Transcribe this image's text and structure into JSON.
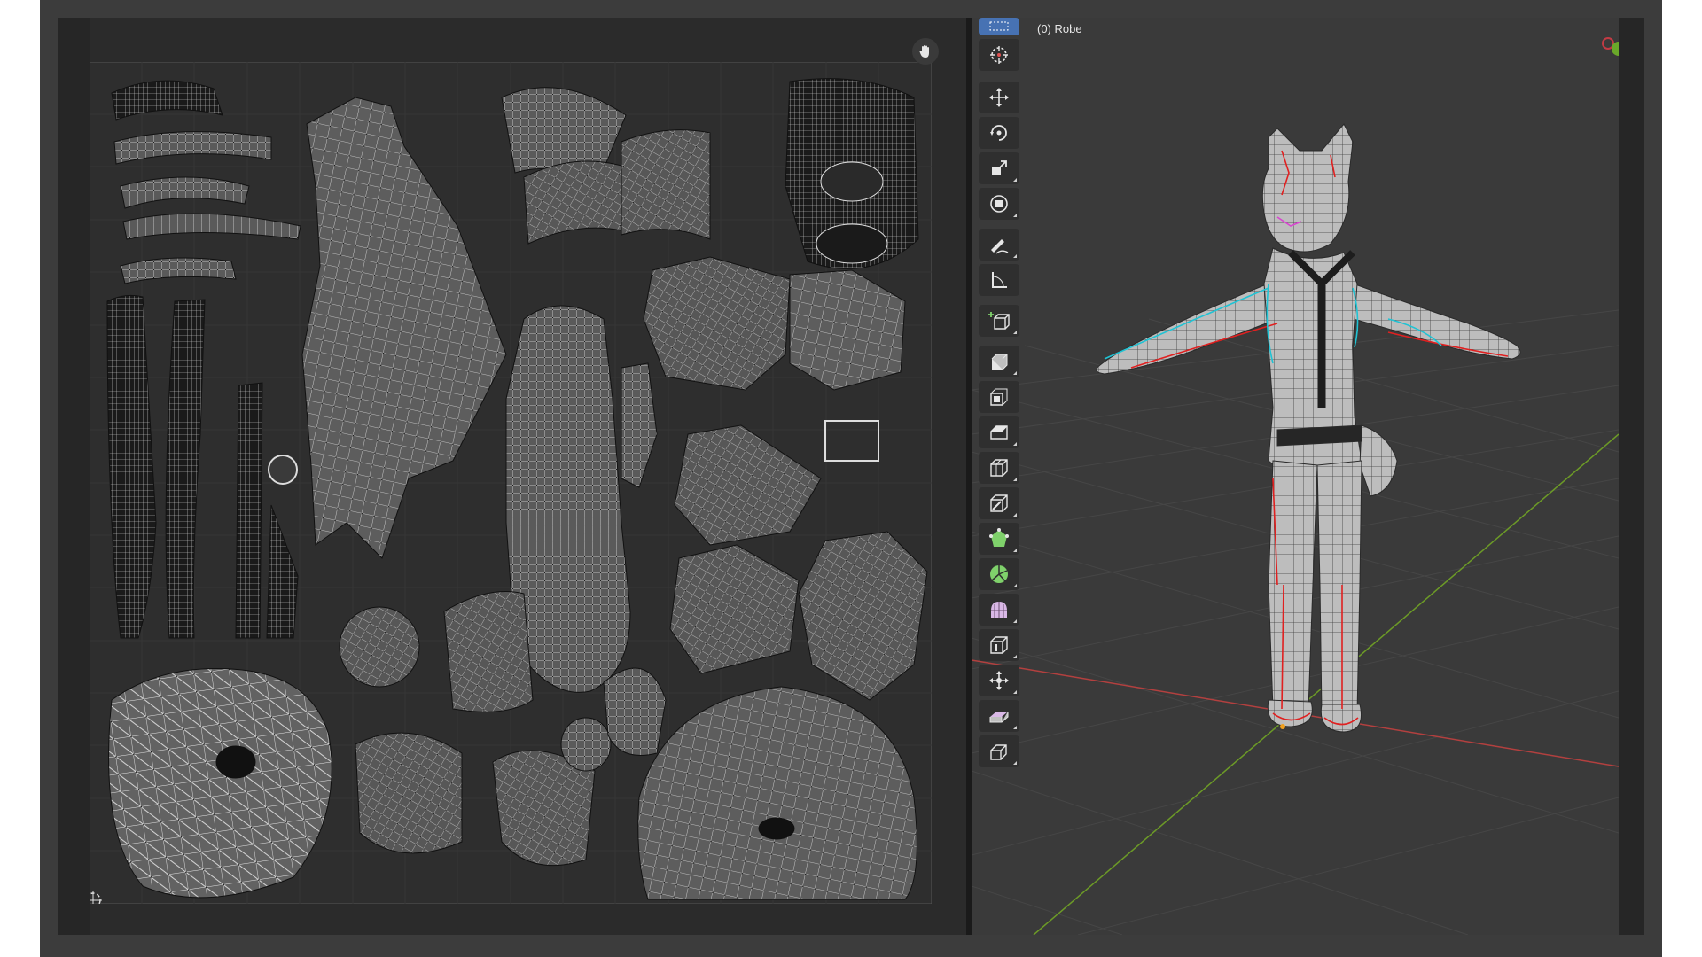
{
  "viewport": {
    "title": "(0) Robe"
  },
  "colors": {
    "background": "#2b2b2b",
    "viewport_bg": "#3a3a3a",
    "grid_line": "#474747",
    "x_axis": "#b3403f",
    "y_axis": "#6c9a27",
    "seam": "#e02020",
    "sharp_edge": "#1fc3d4",
    "mesh": "#d2d2d2",
    "active_tool": "#4772b3"
  },
  "toolbar": {
    "tools": [
      {
        "name": "select-box",
        "icon": "select-box-icon"
      },
      {
        "name": "cursor",
        "icon": "cursor-icon"
      },
      {
        "name": "move",
        "icon": "move-icon"
      },
      {
        "name": "rotate",
        "icon": "rotate-icon"
      },
      {
        "name": "scale",
        "icon": "scale-icon"
      },
      {
        "name": "transform",
        "icon": "transform-icon"
      },
      {
        "name": "annotate",
        "icon": "annotate-icon"
      },
      {
        "name": "measure",
        "icon": "measure-icon"
      },
      {
        "name": "add-cube",
        "icon": "add-cube-icon"
      },
      {
        "name": "extrude-region",
        "icon": "extrude-region-icon"
      },
      {
        "name": "inset-faces",
        "icon": "inset-faces-icon"
      },
      {
        "name": "bevel",
        "icon": "bevel-icon"
      },
      {
        "name": "loop-cut",
        "icon": "loop-cut-icon"
      },
      {
        "name": "knife",
        "icon": "knife-icon"
      },
      {
        "name": "poly-build",
        "icon": "poly-build-icon"
      },
      {
        "name": "spin",
        "icon": "spin-icon"
      },
      {
        "name": "smooth",
        "icon": "smooth-icon"
      },
      {
        "name": "edge-slide",
        "icon": "edge-slide-icon"
      },
      {
        "name": "shrink-fatten",
        "icon": "shrink-fatten-icon"
      },
      {
        "name": "shear",
        "icon": "shear-icon"
      },
      {
        "name": "rip-region",
        "icon": "rip-region-icon"
      }
    ]
  },
  "uv_editor": {
    "hand_icon": "hand-pan-icon",
    "origin_icon": "uv-cursor-icon"
  }
}
